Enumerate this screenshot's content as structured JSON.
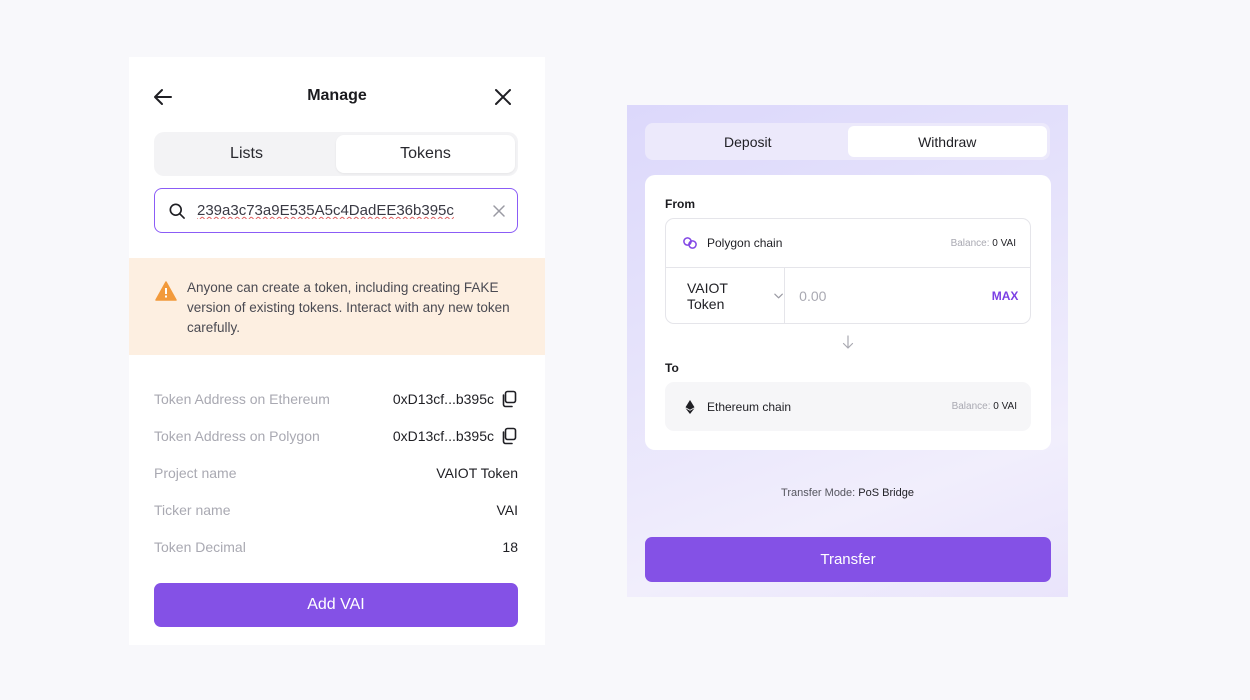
{
  "manage": {
    "title": "Manage",
    "tabs": [
      {
        "label": "Lists",
        "active": false
      },
      {
        "label": "Tokens",
        "active": true
      }
    ],
    "search": {
      "value": "239a3c73a9E535A5c4DadEE36b395c",
      "placeholder": ""
    },
    "warning": "Anyone can create a token, including creating FAKE version of existing tokens. Interact with any new token carefully.",
    "details": [
      {
        "label": "Token Address on Ethereum",
        "value": "0xD13cf...b395c"
      },
      {
        "label": "Token Address on Polygon",
        "value": "0xD13cf...b395c"
      },
      {
        "label": "Project name",
        "value": "VAIOT Token"
      },
      {
        "label": "Ticker name",
        "value": "VAI"
      },
      {
        "label": "Token Decimal",
        "value": "18"
      }
    ],
    "add_button": "Add VAI"
  },
  "bridge": {
    "tabs": [
      {
        "label": "Deposit",
        "active": false
      },
      {
        "label": "Withdraw",
        "active": true
      }
    ],
    "from_label": "From",
    "from": {
      "chain": "Polygon chain",
      "balance_label": "Balance:",
      "balance_value": "0 VAI",
      "token": "VAIOT Token",
      "amount_placeholder": "0.00",
      "max_label": "MAX"
    },
    "to_label": "To",
    "to": {
      "chain": "Ethereum chain",
      "balance_label": "Balance:",
      "balance_value": "0 VAI"
    },
    "transfer_mode_label": "Transfer Mode:",
    "transfer_mode_value": "PoS Bridge",
    "transfer_button": "Transfer"
  },
  "colors": {
    "accent": "#8451e6",
    "accent_text": "#7b3fe4",
    "warning_bg": "#fdefe1",
    "warning_icon": "#f29a3c",
    "search_border": "#8b5cf6"
  },
  "icons": {
    "back": "arrow-left-icon",
    "close": "close-icon",
    "search": "search-icon",
    "clear": "clear-icon",
    "warning": "warning-triangle-icon",
    "copy": "copy-icon",
    "polygon": "polygon-icon",
    "ethereum": "ethereum-icon",
    "dropdown": "chevron-down-icon",
    "arrow_down": "arrow-down-icon"
  }
}
